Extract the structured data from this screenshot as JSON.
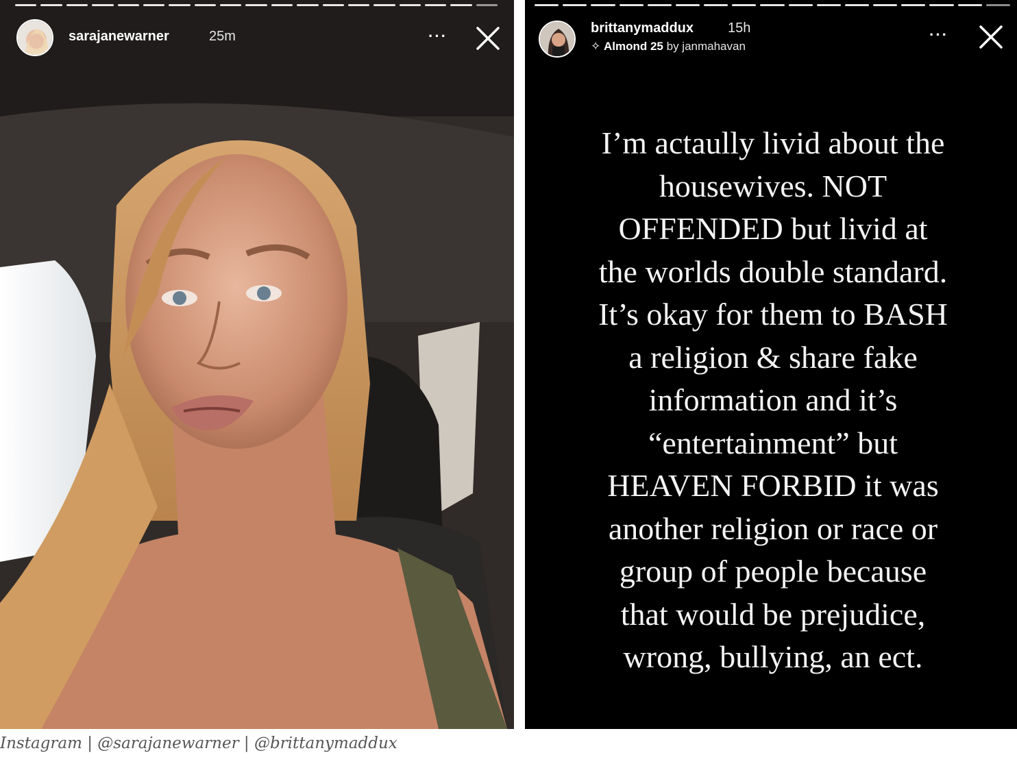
{
  "left_story": {
    "username": "sarajanewarner",
    "time": "25m",
    "more_icon": "more-horizontal-icon",
    "close_icon": "close-icon"
  },
  "right_story": {
    "username": "brittanymaddux",
    "time": "15h",
    "music": "Almond 25",
    "music_by": "by janmahavan",
    "more_icon": "more-horizontal-icon",
    "close_icon": "close-icon",
    "text_lines": [
      "I’m actaully livid about the",
      "housewives. NOT",
      "OFFENDED but livid at",
      "the worlds double standard.",
      "It’s okay for them to BASH",
      "a religion & share fake",
      "information and it’s",
      "“entertainment” but",
      "HEAVEN FORBID it was",
      "another religion or race or",
      "group of people because",
      "that would be prejudice,",
      "wrong, bullying, an ect."
    ]
  },
  "caption": "Instagram | @sarajanewarner | @brittanymaddux",
  "colors": {
    "story_text": "#f4f4f4",
    "caption": "#555555",
    "right_bg": "#000000"
  }
}
